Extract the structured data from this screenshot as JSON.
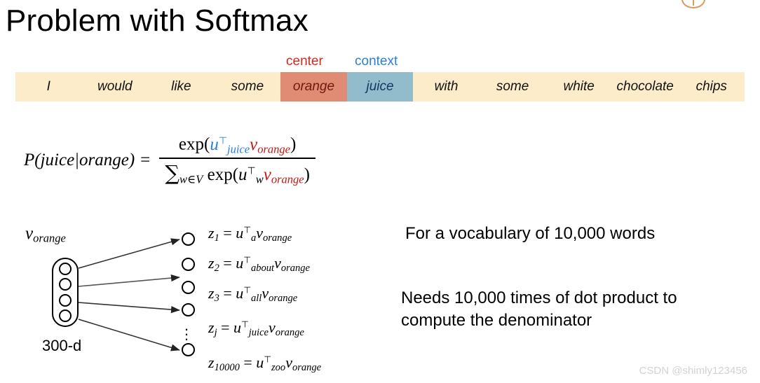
{
  "slide": {
    "title": "Problem with Softmax",
    "watermark": "CSDN @shimly123456"
  },
  "sentence": {
    "labels": {
      "center": "center",
      "context": "context",
      "center_color": "#d32a1c",
      "context_color": "#2b7fd4"
    },
    "background_color": "#fcecc9",
    "center_cell_color": "#e08b73",
    "context_cell_color": "#92bccb",
    "words": [
      {
        "text": "I",
        "role": "plain"
      },
      {
        "text": "would",
        "role": "plain"
      },
      {
        "text": "like",
        "role": "plain"
      },
      {
        "text": "some",
        "role": "plain"
      },
      {
        "text": "orange",
        "role": "center"
      },
      {
        "text": "juice",
        "role": "context"
      },
      {
        "text": "with",
        "role": "plain"
      },
      {
        "text": "some",
        "role": "plain"
      },
      {
        "text": "white",
        "role": "plain"
      },
      {
        "text": "chocolate",
        "role": "plain"
      },
      {
        "text": "chips",
        "role": "plain"
      }
    ]
  },
  "formula": {
    "lhs": "P(juice|orange) =",
    "numerator_text": "exp(u_juice^T v_orange)",
    "denominator_text": "∑_{w∈V} exp(u_w^T v_orange)",
    "parts": {
      "exp_open": "exp(",
      "close_paren": ")",
      "u": "u",
      "transpose": "⊤",
      "sub_juice": "juice",
      "sub_w": "w",
      "v": "v",
      "sub_orange": "orange",
      "sum_symbol": "∑",
      "sum_sub": "w∈V"
    },
    "blue_color": "#2b7fd4",
    "red_color": "#c31a16"
  },
  "diagram": {
    "input_label": "v_orange",
    "input_label_parts": {
      "v": "v",
      "sub": "orange"
    },
    "dimension_label": "300-d",
    "input_dot_count": 4,
    "output_node_count": 5,
    "ellipsis_dots": "⋮",
    "equations": [
      {
        "lhs": "z",
        "lhs_sub": "1",
        "u_sub": "a"
      },
      {
        "lhs": "z",
        "lhs_sub": "2",
        "u_sub": "about"
      },
      {
        "lhs": "z",
        "lhs_sub": "3",
        "u_sub": "all"
      },
      {
        "lhs": "z",
        "lhs_sub": "j",
        "u_sub": "juice"
      },
      {
        "lhs": "z",
        "lhs_sub": "10000",
        "u_sub": "zoo"
      }
    ],
    "equation_common": {
      "equals": "=",
      "u": "u",
      "transpose": "⊤",
      "v": "v",
      "v_sub": "orange"
    }
  },
  "notes": {
    "vocabulary": "For a vocabulary of 10,000 words",
    "cost": "Needs 10,000 times of dot product to compute the denominator"
  }
}
